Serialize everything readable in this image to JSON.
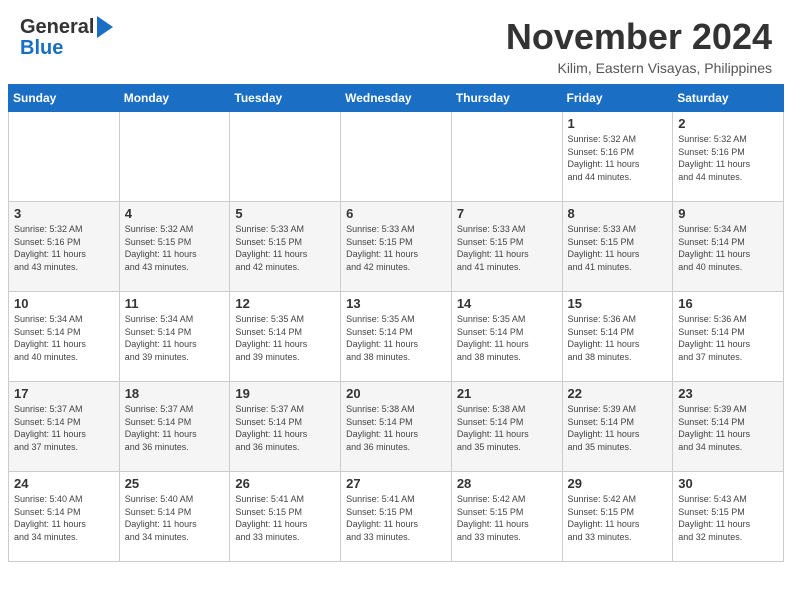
{
  "header": {
    "logo_line1": "General",
    "logo_line2": "Blue",
    "month": "November 2024",
    "location": "Kilim, Eastern Visayas, Philippines"
  },
  "weekdays": [
    "Sunday",
    "Monday",
    "Tuesday",
    "Wednesday",
    "Thursday",
    "Friday",
    "Saturday"
  ],
  "weeks": [
    [
      {
        "day": "",
        "info": ""
      },
      {
        "day": "",
        "info": ""
      },
      {
        "day": "",
        "info": ""
      },
      {
        "day": "",
        "info": ""
      },
      {
        "day": "",
        "info": ""
      },
      {
        "day": "1",
        "info": "Sunrise: 5:32 AM\nSunset: 5:16 PM\nDaylight: 11 hours\nand 44 minutes."
      },
      {
        "day": "2",
        "info": "Sunrise: 5:32 AM\nSunset: 5:16 PM\nDaylight: 11 hours\nand 44 minutes."
      }
    ],
    [
      {
        "day": "3",
        "info": "Sunrise: 5:32 AM\nSunset: 5:16 PM\nDaylight: 11 hours\nand 43 minutes."
      },
      {
        "day": "4",
        "info": "Sunrise: 5:32 AM\nSunset: 5:15 PM\nDaylight: 11 hours\nand 43 minutes."
      },
      {
        "day": "5",
        "info": "Sunrise: 5:33 AM\nSunset: 5:15 PM\nDaylight: 11 hours\nand 42 minutes."
      },
      {
        "day": "6",
        "info": "Sunrise: 5:33 AM\nSunset: 5:15 PM\nDaylight: 11 hours\nand 42 minutes."
      },
      {
        "day": "7",
        "info": "Sunrise: 5:33 AM\nSunset: 5:15 PM\nDaylight: 11 hours\nand 41 minutes."
      },
      {
        "day": "8",
        "info": "Sunrise: 5:33 AM\nSunset: 5:15 PM\nDaylight: 11 hours\nand 41 minutes."
      },
      {
        "day": "9",
        "info": "Sunrise: 5:34 AM\nSunset: 5:14 PM\nDaylight: 11 hours\nand 40 minutes."
      }
    ],
    [
      {
        "day": "10",
        "info": "Sunrise: 5:34 AM\nSunset: 5:14 PM\nDaylight: 11 hours\nand 40 minutes."
      },
      {
        "day": "11",
        "info": "Sunrise: 5:34 AM\nSunset: 5:14 PM\nDaylight: 11 hours\nand 39 minutes."
      },
      {
        "day": "12",
        "info": "Sunrise: 5:35 AM\nSunset: 5:14 PM\nDaylight: 11 hours\nand 39 minutes."
      },
      {
        "day": "13",
        "info": "Sunrise: 5:35 AM\nSunset: 5:14 PM\nDaylight: 11 hours\nand 38 minutes."
      },
      {
        "day": "14",
        "info": "Sunrise: 5:35 AM\nSunset: 5:14 PM\nDaylight: 11 hours\nand 38 minutes."
      },
      {
        "day": "15",
        "info": "Sunrise: 5:36 AM\nSunset: 5:14 PM\nDaylight: 11 hours\nand 38 minutes."
      },
      {
        "day": "16",
        "info": "Sunrise: 5:36 AM\nSunset: 5:14 PM\nDaylight: 11 hours\nand 37 minutes."
      }
    ],
    [
      {
        "day": "17",
        "info": "Sunrise: 5:37 AM\nSunset: 5:14 PM\nDaylight: 11 hours\nand 37 minutes."
      },
      {
        "day": "18",
        "info": "Sunrise: 5:37 AM\nSunset: 5:14 PM\nDaylight: 11 hours\nand 36 minutes."
      },
      {
        "day": "19",
        "info": "Sunrise: 5:37 AM\nSunset: 5:14 PM\nDaylight: 11 hours\nand 36 minutes."
      },
      {
        "day": "20",
        "info": "Sunrise: 5:38 AM\nSunset: 5:14 PM\nDaylight: 11 hours\nand 36 minutes."
      },
      {
        "day": "21",
        "info": "Sunrise: 5:38 AM\nSunset: 5:14 PM\nDaylight: 11 hours\nand 35 minutes."
      },
      {
        "day": "22",
        "info": "Sunrise: 5:39 AM\nSunset: 5:14 PM\nDaylight: 11 hours\nand 35 minutes."
      },
      {
        "day": "23",
        "info": "Sunrise: 5:39 AM\nSunset: 5:14 PM\nDaylight: 11 hours\nand 34 minutes."
      }
    ],
    [
      {
        "day": "24",
        "info": "Sunrise: 5:40 AM\nSunset: 5:14 PM\nDaylight: 11 hours\nand 34 minutes."
      },
      {
        "day": "25",
        "info": "Sunrise: 5:40 AM\nSunset: 5:14 PM\nDaylight: 11 hours\nand 34 minutes."
      },
      {
        "day": "26",
        "info": "Sunrise: 5:41 AM\nSunset: 5:15 PM\nDaylight: 11 hours\nand 33 minutes."
      },
      {
        "day": "27",
        "info": "Sunrise: 5:41 AM\nSunset: 5:15 PM\nDaylight: 11 hours\nand 33 minutes."
      },
      {
        "day": "28",
        "info": "Sunrise: 5:42 AM\nSunset: 5:15 PM\nDaylight: 11 hours\nand 33 minutes."
      },
      {
        "day": "29",
        "info": "Sunrise: 5:42 AM\nSunset: 5:15 PM\nDaylight: 11 hours\nand 33 minutes."
      },
      {
        "day": "30",
        "info": "Sunrise: 5:43 AM\nSunset: 5:15 PM\nDaylight: 11 hours\nand 32 minutes."
      }
    ]
  ]
}
